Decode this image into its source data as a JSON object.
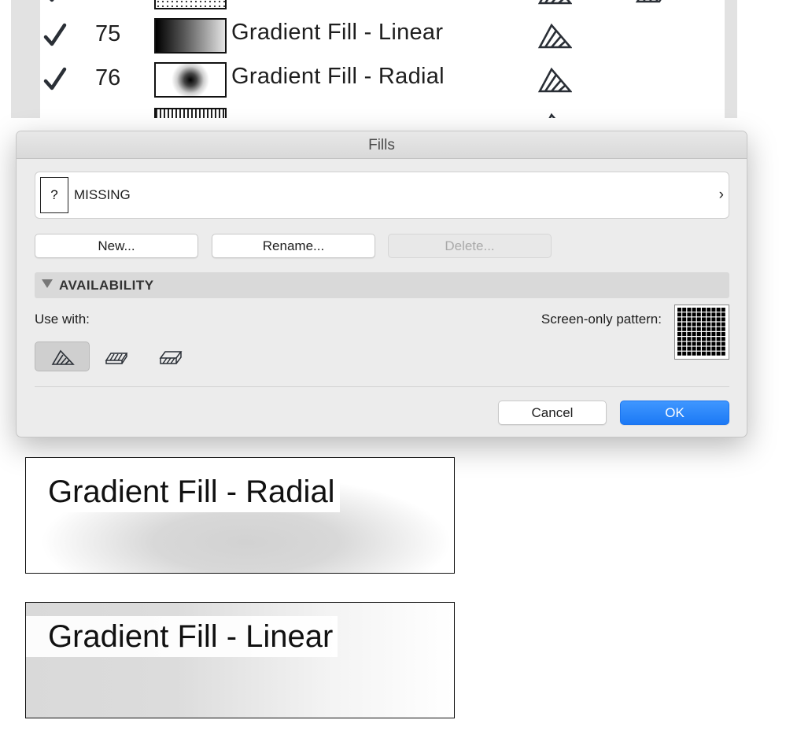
{
  "fill_list": {
    "rows": [
      {
        "number": "",
        "name": ""
      },
      {
        "number": "75",
        "name": "Gradient Fill - Linear"
      },
      {
        "number": "76",
        "name": "Gradient Fill - Radial"
      },
      {
        "number": "",
        "name": ""
      }
    ]
  },
  "dialog": {
    "title": "Fills",
    "selected_fill": "MISSING",
    "missing_icon_glyph": "?",
    "chevron": "›",
    "buttons": {
      "new": "New...",
      "rename": "Rename...",
      "delete": "Delete...",
      "cancel": "Cancel",
      "ok": "OK"
    },
    "availability": {
      "header": "AVAILABILITY",
      "use_with_label": "Use with:",
      "screen_only_label": "Screen-only pattern:",
      "tools": [
        {
          "icon": "drafting-fill-icon",
          "active": true
        },
        {
          "icon": "cut-fill-icon",
          "active": false
        },
        {
          "icon": "cover-fill-icon",
          "active": false
        }
      ]
    }
  },
  "previews": {
    "radial": "Gradient Fill - Radial",
    "linear": "Gradient Fill - Linear"
  },
  "colors": {
    "accent": "#1c79f5",
    "dialog_bg": "#ececec",
    "list_bg": "#e2e2e2"
  }
}
